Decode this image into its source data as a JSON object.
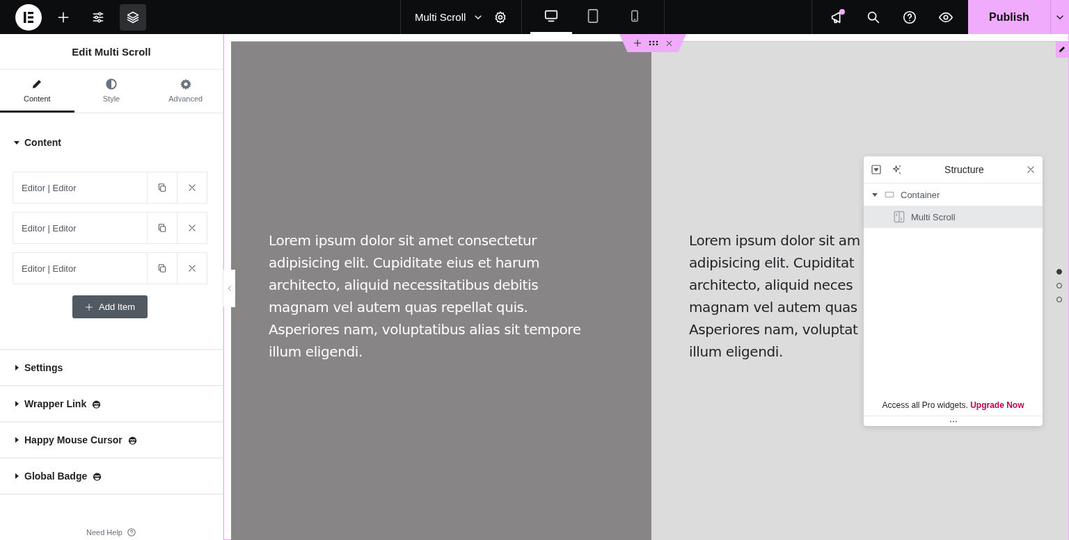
{
  "topbar": {
    "tools": [
      {
        "kind": "logo",
        "selected": false
      },
      {
        "kind": "add",
        "selected": false
      },
      {
        "kind": "sliders",
        "selected": false
      },
      {
        "kind": "layers",
        "selected": true
      }
    ],
    "document_title": "Multi Scroll",
    "devices": [
      {
        "kind": "desktop",
        "selected": true
      },
      {
        "kind": "tablet",
        "selected": false
      },
      {
        "kind": "mobile",
        "selected": false
      }
    ],
    "actions": [
      {
        "kind": "announcements",
        "unread": true
      },
      {
        "kind": "search",
        "unread": false
      },
      {
        "kind": "help",
        "unread": false
      },
      {
        "kind": "preview",
        "unread": false
      }
    ],
    "publish": "Publish"
  },
  "panel": {
    "title": "Edit Multi Scroll",
    "tabs": [
      {
        "label": "Content",
        "kind": "pencil",
        "selected": true
      },
      {
        "label": "Style",
        "kind": "contrast",
        "selected": false
      },
      {
        "label": "Advanced",
        "kind": "gear",
        "selected": false
      }
    ],
    "sections": [
      {
        "title": "Content",
        "expanded": true,
        "pro": false,
        "items": [
          "Editor | Editor",
          "Editor | Editor",
          "Editor | Editor"
        ],
        "add_item": "Add Item"
      },
      {
        "title": "Settings",
        "expanded": false,
        "pro": false
      },
      {
        "title": "Wrapper Link",
        "expanded": false,
        "pro": true
      },
      {
        "title": "Happy Mouse Cursor",
        "expanded": false,
        "pro": true
      },
      {
        "title": "Global Badge",
        "expanded": false,
        "pro": true
      }
    ],
    "help": "Need Help"
  },
  "canvas": {
    "columns": [
      {
        "lines": [
          "Lorem ipsum dolor sit amet consectetur",
          "adipisicing elit. Cupiditate eius et harum",
          "architecto, aliquid necessitatibus debitis",
          "magnam vel autem quas repellat quis.",
          "Asperiores nam, voluptatibus alias sit tempore",
          "illum eligendi."
        ]
      },
      {
        "lines": [
          "Lorem ipsum dolor sit am",
          "adipisicing elit. Cupiditat",
          "architecto, aliquid neces",
          "magnam vel autem quas",
          "Asperiores nam, voluptat",
          "illum eligendi."
        ]
      }
    ],
    "dots": [
      {
        "selected": true
      },
      {
        "selected": false
      },
      {
        "selected": false
      }
    ]
  },
  "structure": {
    "title": "Structure",
    "tree": [
      {
        "label": "Container",
        "kind": "container",
        "expanded": true,
        "selected": false,
        "children": [
          {
            "label": "Multi Scroll",
            "kind": "widget",
            "selected": true
          }
        ]
      }
    ],
    "promo": "Access all Pro widgets.",
    "upgrade": "Upgrade Now"
  }
}
